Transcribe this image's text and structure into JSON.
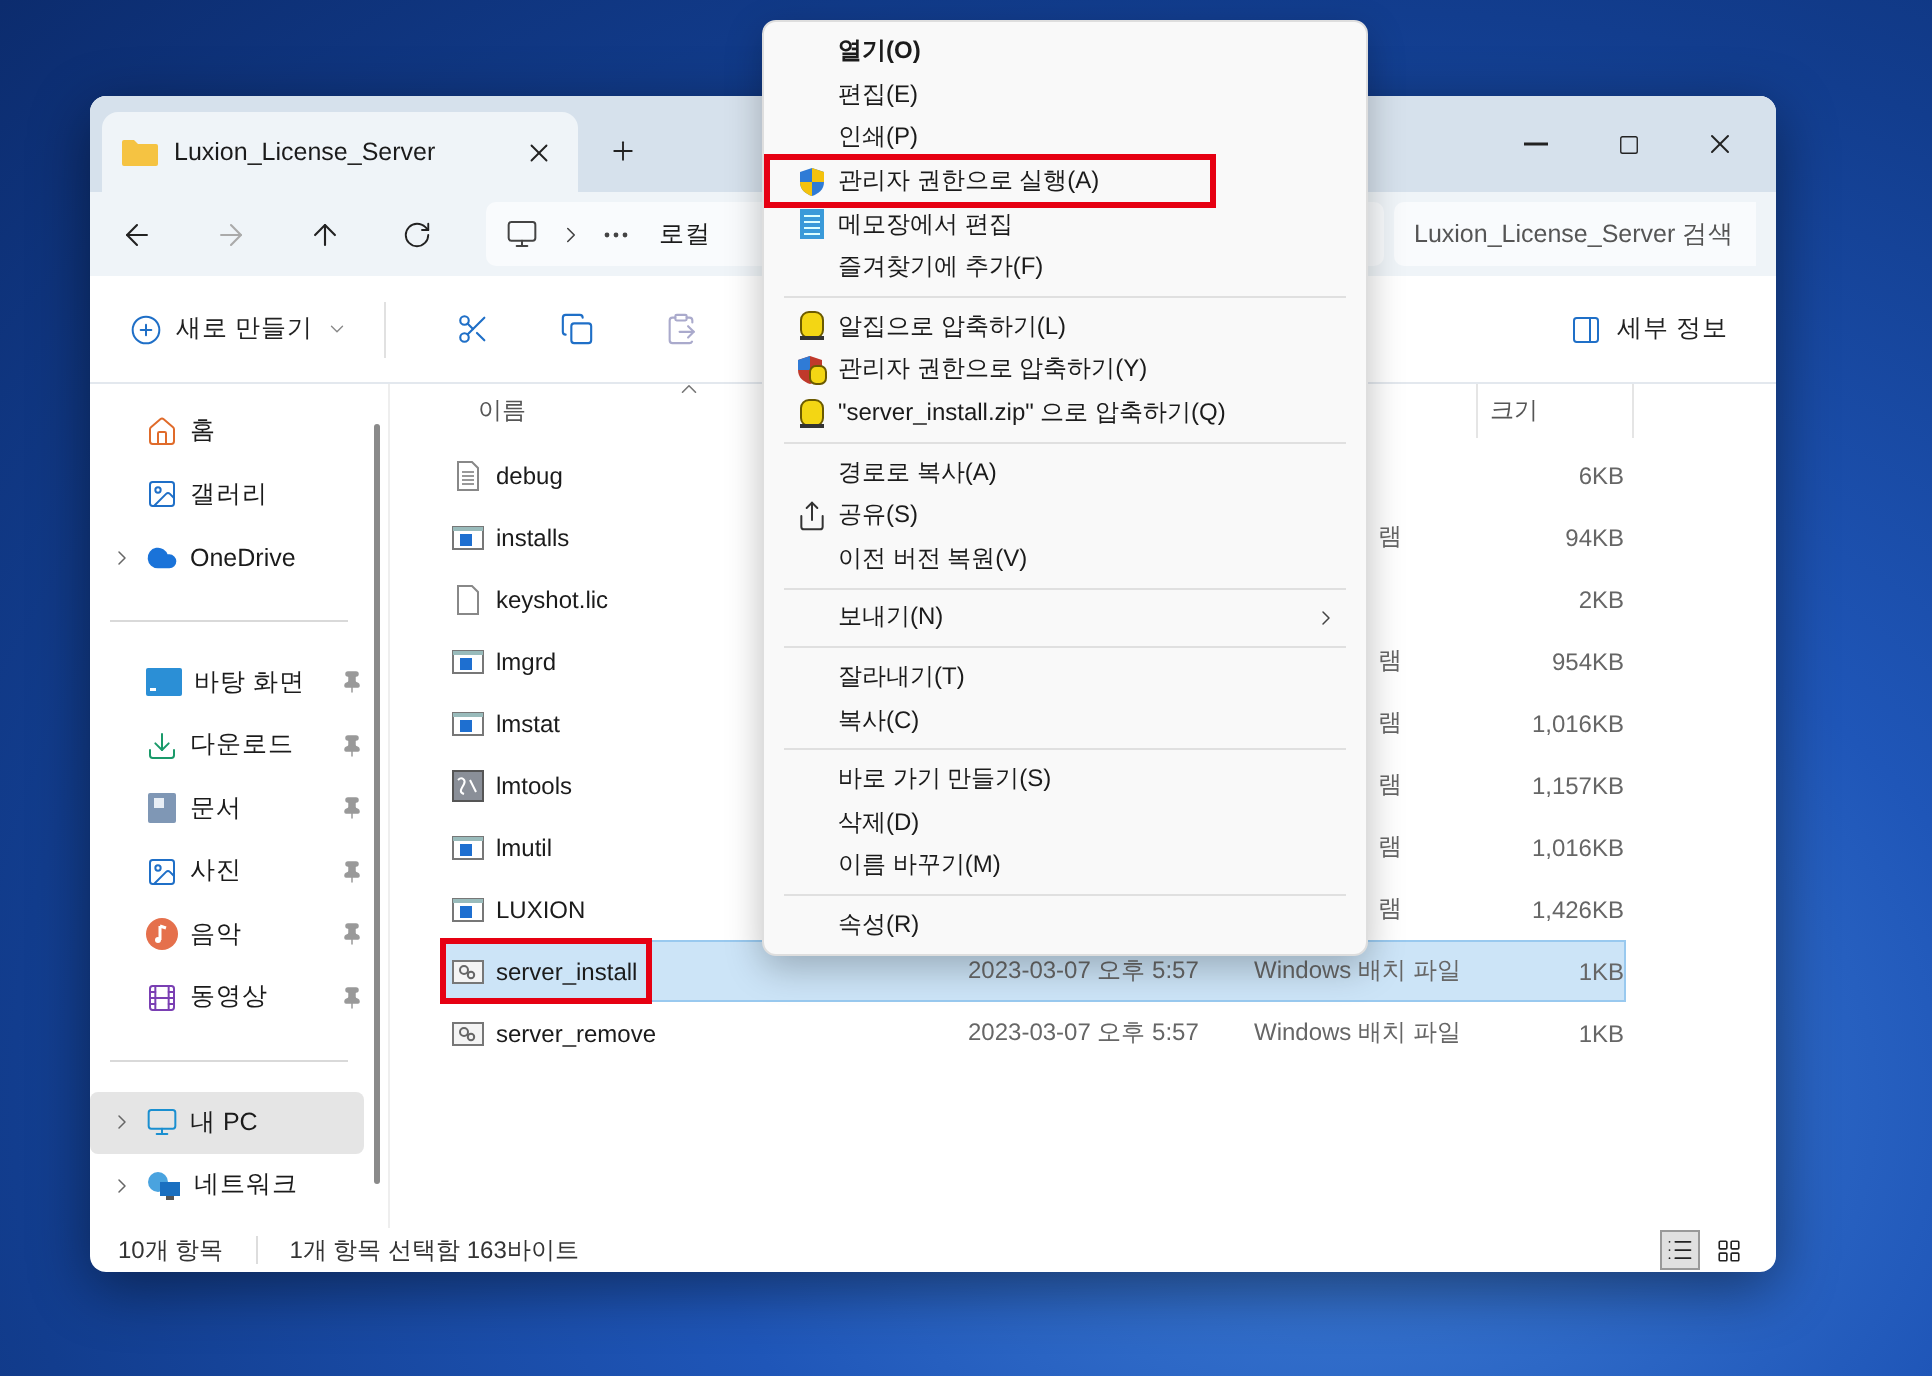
{
  "window": {
    "tab_title": "Luxion_License_Server"
  },
  "address": {
    "crumb": "로컬",
    "search_placeholder": "Luxion_License_Server 검색"
  },
  "toolbar": {
    "new_label": "새로 만들기",
    "details_label": "세부 정보"
  },
  "sidebar": {
    "items": [
      {
        "kind": "home",
        "label": "홈",
        "pinned": false,
        "expandable": false,
        "selected": false
      },
      {
        "kind": "gallery",
        "label": "갤러리",
        "pinned": false,
        "expandable": false,
        "selected": false
      },
      {
        "kind": "cloud",
        "label": "OneDrive",
        "pinned": false,
        "expandable": true,
        "selected": false
      },
      {
        "kind": "divider"
      },
      {
        "kind": "desktop",
        "label": "바탕 화면",
        "pinned": true,
        "expandable": false,
        "selected": false
      },
      {
        "kind": "download",
        "label": "다운로드",
        "pinned": true,
        "expandable": false,
        "selected": false
      },
      {
        "kind": "document",
        "label": "문서",
        "pinned": true,
        "expandable": false,
        "selected": false
      },
      {
        "kind": "picture",
        "label": "사진",
        "pinned": true,
        "expandable": false,
        "selected": false
      },
      {
        "kind": "music",
        "label": "음악",
        "pinned": true,
        "expandable": false,
        "selected": false
      },
      {
        "kind": "video",
        "label": "동영상",
        "pinned": true,
        "expandable": false,
        "selected": false
      },
      {
        "kind": "divider"
      },
      {
        "kind": "pc",
        "label": "내 PC",
        "pinned": false,
        "expandable": true,
        "selected": true
      },
      {
        "kind": "network",
        "label": "네트워크",
        "pinned": false,
        "expandable": true,
        "selected": false
      }
    ]
  },
  "table": {
    "columns": [
      "이름",
      "크기"
    ],
    "rows": [
      {
        "kind": "text",
        "name": "debug",
        "size": "6KB",
        "selected": false,
        "annotated": false
      },
      {
        "kind": "app",
        "name": "installs",
        "type": "램",
        "type_cut": true,
        "size": "94KB",
        "selected": false,
        "annotated": false
      },
      {
        "kind": "file",
        "name": "keyshot.lic",
        "size": "2KB",
        "selected": false,
        "annotated": false
      },
      {
        "kind": "app",
        "name": "lmgrd",
        "type": "램",
        "type_cut": true,
        "size": "954KB",
        "selected": false,
        "annotated": false
      },
      {
        "kind": "app",
        "name": "lmstat",
        "type": "램",
        "type_cut": true,
        "size": "1,016KB",
        "selected": false,
        "annotated": false
      },
      {
        "kind": "tool",
        "name": "lmtools",
        "type": "램",
        "type_cut": true,
        "size": "1,157KB",
        "selected": false,
        "annotated": false
      },
      {
        "kind": "app",
        "name": "lmutil",
        "type": "램",
        "type_cut": true,
        "size": "1,016KB",
        "selected": false,
        "annotated": false
      },
      {
        "kind": "app",
        "name": "LUXION",
        "type": "램",
        "type_cut": true,
        "size": "1,426KB",
        "selected": false,
        "annotated": false
      },
      {
        "kind": "batch",
        "name": "server_install",
        "date": "2023-03-07 오후 5:57",
        "type": "Windows 배치 파일",
        "type_cut": false,
        "size": "1KB",
        "selected": true,
        "annotated": true
      },
      {
        "kind": "batch",
        "name": "server_remove",
        "date": "2023-03-07 오후 5:57",
        "type": "Windows 배치 파일",
        "type_cut": false,
        "size": "1KB",
        "selected": false,
        "annotated": false
      }
    ]
  },
  "status_bar": [
    "10개 항목",
    "1개 항목 선택함 163바이트"
  ],
  "context_menu": {
    "items": [
      {
        "kind": "plain",
        "label": "열기(O)",
        "bold": true,
        "submenu": false,
        "annotated": false
      },
      {
        "kind": "plain",
        "label": "편집(E)",
        "bold": false,
        "submenu": false,
        "annotated": false
      },
      {
        "kind": "plain",
        "label": "인쇄(P)",
        "bold": false,
        "submenu": false,
        "annotated": false
      },
      {
        "kind": "shield",
        "label": "관리자 권한으로 실행(A)",
        "bold": false,
        "submenu": false,
        "annotated": true
      },
      {
        "kind": "notepad",
        "label": "메모장에서 편집",
        "bold": false,
        "submenu": false,
        "annotated": false
      },
      {
        "kind": "plain",
        "label": "즐겨찾기에 추가(F)",
        "bold": false,
        "submenu": false,
        "annotated": false
      },
      {
        "kind": "separator"
      },
      {
        "kind": "archive",
        "label": "알집으로 압축하기(L)",
        "bold": false,
        "submenu": false,
        "annotated": false
      },
      {
        "kind": "archive-admin",
        "label": "관리자 권한으로 압축하기(Y)",
        "bold": false,
        "submenu": false,
        "annotated": false
      },
      {
        "kind": "archive",
        "label": "\"server_install.zip\" 으로 압축하기(Q)",
        "bold": false,
        "submenu": false,
        "annotated": false
      },
      {
        "kind": "separator"
      },
      {
        "kind": "plain",
        "label": "경로로 복사(A)",
        "bold": false,
        "submenu": false,
        "annotated": false
      },
      {
        "kind": "share",
        "label": "공유(S)",
        "bold": false,
        "submenu": false,
        "annotated": false
      },
      {
        "kind": "plain",
        "label": "이전 버전 복원(V)",
        "bold": false,
        "submenu": false,
        "annotated": false
      },
      {
        "kind": "separator"
      },
      {
        "kind": "plain",
        "label": "보내기(N)",
        "bold": false,
        "submenu": true,
        "annotated": false
      },
      {
        "kind": "separator"
      },
      {
        "kind": "plain",
        "label": "잘라내기(T)",
        "bold": false,
        "submenu": false,
        "annotated": false
      },
      {
        "kind": "plain",
        "label": "복사(C)",
        "bold": false,
        "submenu": false,
        "annotated": false
      },
      {
        "kind": "separator"
      },
      {
        "kind": "plain",
        "label": "바로 가기 만들기(S)",
        "bold": false,
        "submenu": false,
        "annotated": false
      },
      {
        "kind": "plain",
        "label": "삭제(D)",
        "bold": false,
        "submenu": false,
        "annotated": false
      },
      {
        "kind": "plain",
        "label": "이름 바꾸기(M)",
        "bold": false,
        "submenu": false,
        "annotated": false
      },
      {
        "kind": "separator"
      },
      {
        "kind": "plain",
        "label": "속성(R)",
        "bold": false,
        "submenu": false,
        "annotated": false
      }
    ]
  }
}
